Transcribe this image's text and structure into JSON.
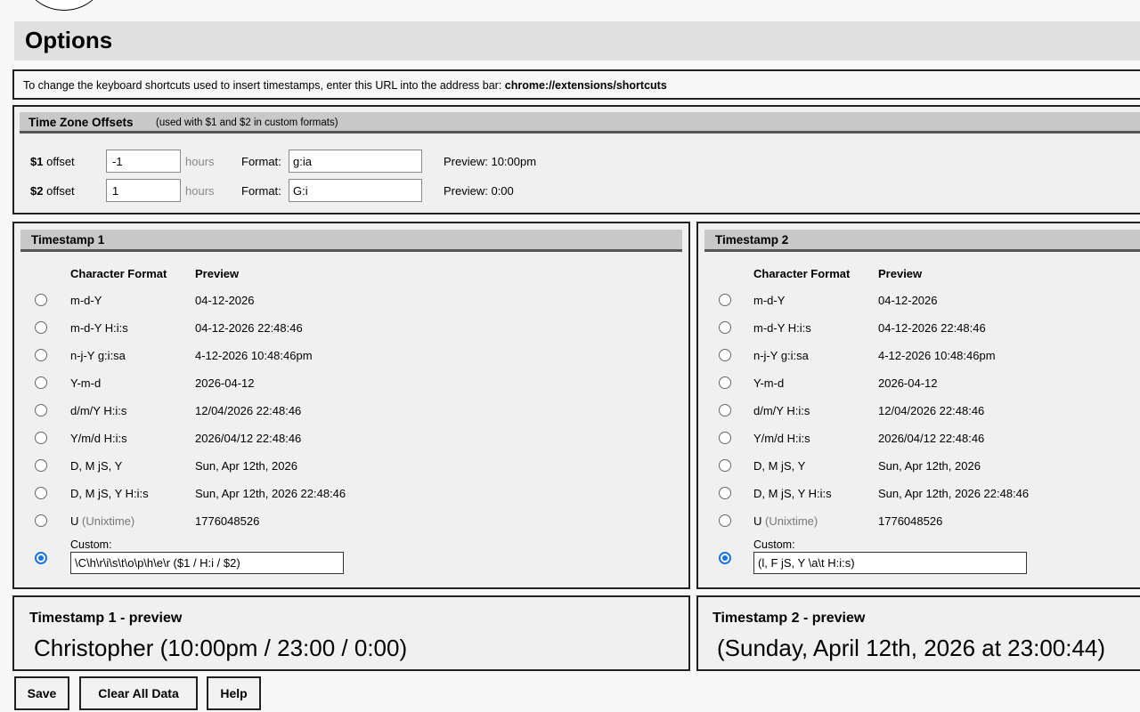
{
  "header": {
    "title": "Options"
  },
  "info": {
    "text": "To change the keyboard shortcuts used to insert timestamps, enter this URL into the address bar: ",
    "url": "chrome://extensions/shortcuts"
  },
  "timezone": {
    "title": "Time Zone Offsets",
    "subtitle": "(used with $1 and $2 in custom formats)",
    "rows": [
      {
        "var": "$1",
        "label": "offset",
        "value": "-1",
        "hours": "hours",
        "format_label": "Format:",
        "format": "g:ia",
        "preview": "Preview: 10:00pm"
      },
      {
        "var": "$2",
        "label": "offset",
        "value": "1",
        "hours": "hours",
        "format_label": "Format:",
        "format": "G:i",
        "preview": "Preview: 0:00"
      }
    ]
  },
  "timestamp1": {
    "title": "Timestamp 1",
    "col_format": "Character Format",
    "col_preview": "Preview",
    "options": [
      {
        "format": "m-d-Y",
        "note": "",
        "preview": "04-12-2026"
      },
      {
        "format": "m-d-Y H:i:s",
        "note": "",
        "preview": "04-12-2026 22:48:46"
      },
      {
        "format": "n-j-Y g:i:sa",
        "note": "",
        "preview": "4-12-2026 10:48:46pm"
      },
      {
        "format": "Y-m-d",
        "note": "",
        "preview": "2026-04-12"
      },
      {
        "format": "d/m/Y H:i:s",
        "note": "",
        "preview": "12/04/2026 22:48:46"
      },
      {
        "format": "Y/m/d H:i:s",
        "note": "",
        "preview": "2026/04/12 22:48:46"
      },
      {
        "format": "D, M jS, Y",
        "note": "",
        "preview": "Sun, Apr 12th, 2026"
      },
      {
        "format": "D, M jS, Y H:i:s",
        "note": "",
        "preview": "Sun, Apr 12th, 2026 22:48:46"
      },
      {
        "format": "U",
        "note": "(Unixtime)",
        "preview": "1776048526"
      }
    ],
    "custom_label": "Custom:",
    "custom_value": "\\C\\h\\r\\i\\s\\t\\o\\p\\h\\e\\r ($1 / H:i / $2)",
    "custom_selected": true
  },
  "timestamp2": {
    "title": "Timestamp 2",
    "col_format": "Character Format",
    "col_preview": "Preview",
    "options": [
      {
        "format": "m-d-Y",
        "note": "",
        "preview": "04-12-2026"
      },
      {
        "format": "m-d-Y H:i:s",
        "note": "",
        "preview": "04-12-2026 22:48:46"
      },
      {
        "format": "n-j-Y g:i:sa",
        "note": "",
        "preview": "4-12-2026 10:48:46pm"
      },
      {
        "format": "Y-m-d",
        "note": "",
        "preview": "2026-04-12"
      },
      {
        "format": "d/m/Y H:i:s",
        "note": "",
        "preview": "12/04/2026 22:48:46"
      },
      {
        "format": "Y/m/d H:i:s",
        "note": "",
        "preview": "2026/04/12 22:48:46"
      },
      {
        "format": "D, M jS, Y",
        "note": "",
        "preview": "Sun, Apr 12th, 2026"
      },
      {
        "format": "D, M jS, Y H:i:s",
        "note": "",
        "preview": "Sun, Apr 12th, 2026 22:48:46"
      },
      {
        "format": "U",
        "note": "(Unixtime)",
        "preview": "1776048526"
      }
    ],
    "custom_label": "Custom:",
    "custom_value": "(l, F jS, Y \\a\\t H:i:s)",
    "custom_selected": true
  },
  "preview1": {
    "title": "Timestamp 1 - preview",
    "text": "Christopher (10:00pm / 23:00 / 0:00)"
  },
  "preview2": {
    "title": "Timestamp 2 - preview",
    "text": "(Sunday, April 12th, 2026 at 23:00:44)"
  },
  "buttons": {
    "save": "Save",
    "clear": "Clear All Data",
    "help": "Help"
  },
  "colors": {
    "radio_accent": "#1a73e8",
    "section_header": "#c8c8c8"
  }
}
